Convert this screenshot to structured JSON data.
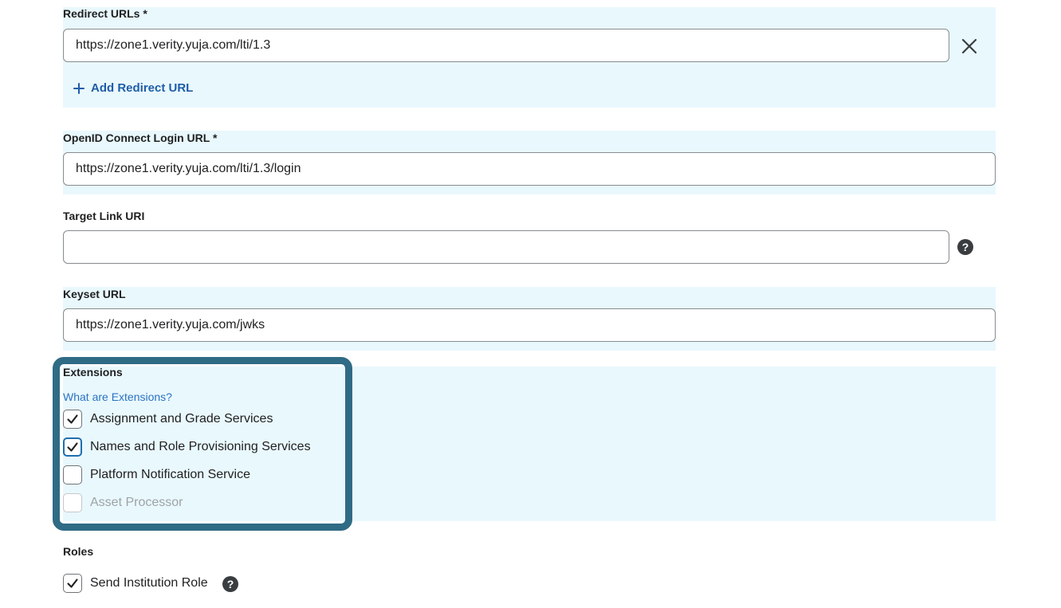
{
  "redirect": {
    "label": "Redirect URLs *",
    "value": "https://zone1.verity.yuja.com/lti/1.3",
    "add_label": "Add Redirect URL"
  },
  "openid": {
    "label": "OpenID Connect Login URL *",
    "value": "https://zone1.verity.yuja.com/lti/1.3/login"
  },
  "target": {
    "label": "Target Link URI",
    "value": ""
  },
  "keyset": {
    "label": "Keyset URL",
    "value": "https://zone1.verity.yuja.com/jwks"
  },
  "extensions": {
    "label": "Extensions",
    "help_link": "What are Extensions?",
    "items": [
      {
        "label": "Assignment and Grade Services",
        "checked": true,
        "disabled": false
      },
      {
        "label": "Names and Role Provisioning Services",
        "checked": true,
        "disabled": false
      },
      {
        "label": "Platform Notification Service",
        "checked": false,
        "disabled": false
      },
      {
        "label": "Asset Processor",
        "checked": false,
        "disabled": true
      }
    ]
  },
  "roles": {
    "label": "Roles",
    "send_institution_role": {
      "label": "Send Institution Role",
      "checked": true
    }
  },
  "colors": {
    "section_bg": "#e9f8fd",
    "highlight_frame": "#2f6b85",
    "link": "#2a73c2"
  },
  "icons": {
    "close": "close-icon",
    "add": "plus-icon",
    "help": "help-icon",
    "check": "checkmark-icon"
  }
}
